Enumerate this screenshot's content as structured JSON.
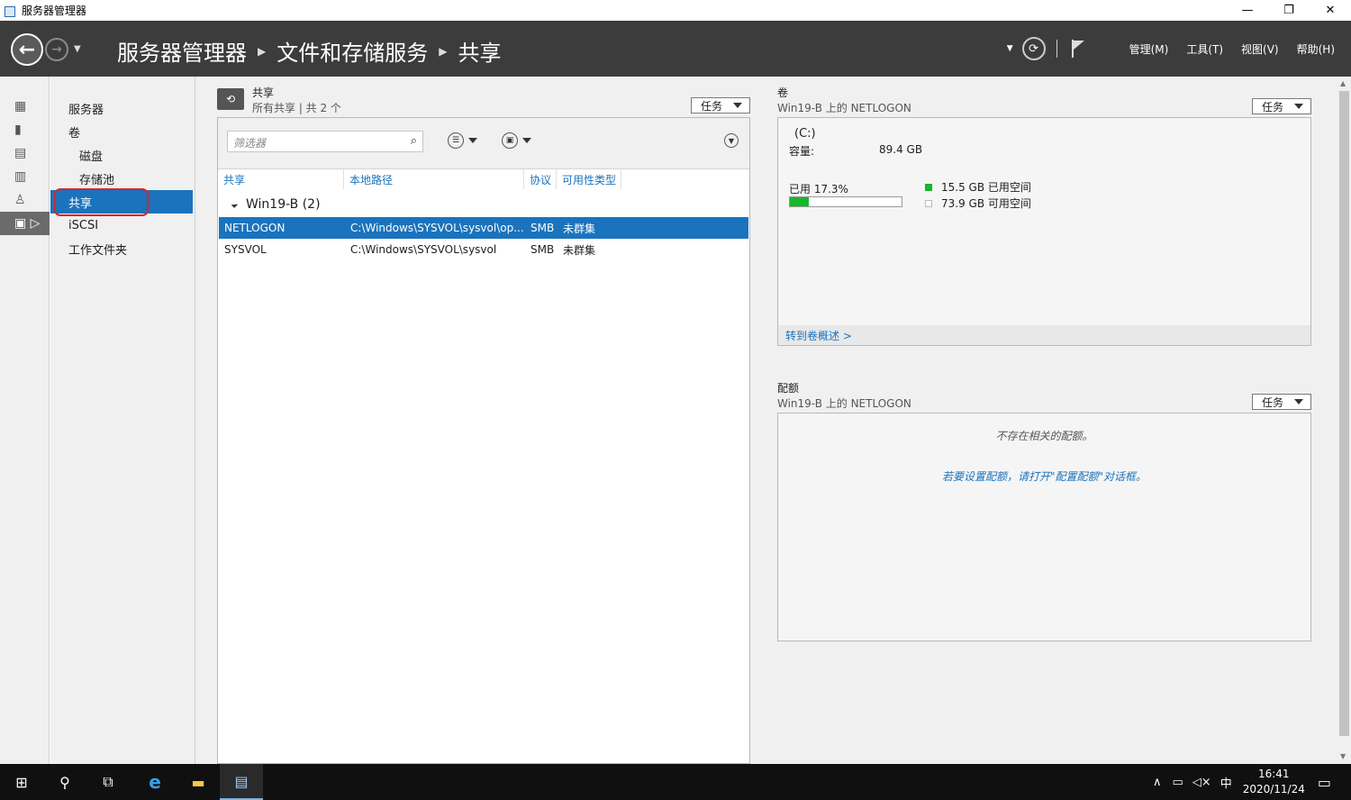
{
  "window": {
    "title": "服务器管理器",
    "minimize": "—",
    "restore": "❐",
    "close": "✕"
  },
  "header": {
    "breadcrumb": [
      "服务器管理器",
      "文件和存储服务",
      "共享"
    ],
    "menus": [
      "管理(M)",
      "工具(T)",
      "视图(V)",
      "帮助(H)"
    ]
  },
  "sidebar": {
    "items": [
      {
        "label": "服务器",
        "level": 0,
        "selected": false
      },
      {
        "label": "卷",
        "level": 0,
        "selected": false
      },
      {
        "label": "磁盘",
        "level": 1,
        "selected": false
      },
      {
        "label": "存储池",
        "level": 1,
        "selected": false
      },
      {
        "label": "共享",
        "level": 0,
        "selected": true
      },
      {
        "label": "iSCSI",
        "level": 0,
        "selected": false
      },
      {
        "label": "工作文件夹",
        "level": 0,
        "selected": false
      }
    ]
  },
  "shares": {
    "title": "共享",
    "subtitle": "所有共享 | 共 2 个",
    "tasks_label": "任务",
    "filter_placeholder": "筛选器",
    "columns": [
      "共享",
      "本地路径",
      "协议",
      "可用性类型"
    ],
    "group": "Win19-B (2)",
    "rows": [
      {
        "share": "NETLOGON",
        "path": "C:\\Windows\\SYSVOL\\sysvol\\op...",
        "protocol": "SMB",
        "availability": "未群集",
        "selected": true
      },
      {
        "share": "SYSVOL",
        "path": "C:\\Windows\\SYSVOL\\sysvol",
        "protocol": "SMB",
        "availability": "未群集",
        "selected": false
      }
    ]
  },
  "volume": {
    "title": "卷",
    "subtitle": "Win19-B 上的 NETLOGON",
    "tasks_label": "任务",
    "drive": "(C:)",
    "capacity_label": "容量:",
    "capacity_value": "89.4 GB",
    "used_label": "已用 17.3%",
    "used_fraction": 0.173,
    "used_space": "15.5 GB 已用空间",
    "free_space": "73.9 GB 可用空间",
    "used_color": "#16b72a",
    "link": "转到卷概述 >"
  },
  "quota": {
    "title": "配额",
    "subtitle": "Win19-B 上的 NETLOGON",
    "tasks_label": "任务",
    "empty_msg": "不存在相关的配额。",
    "hint": "若要设置配额，请打开\"配置配额\"对话框。"
  },
  "taskbar": {
    "time": "16:41",
    "date": "2020/11/24",
    "ime": "中"
  }
}
